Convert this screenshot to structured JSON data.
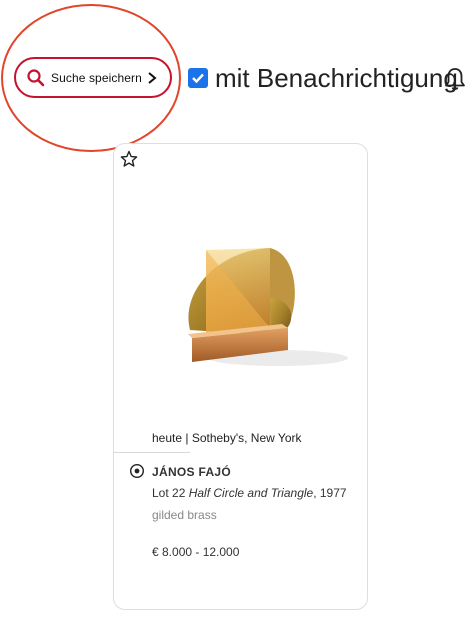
{
  "save_search": {
    "label": "Suche speichern",
    "icon": "search-icon",
    "color": "#c4122f"
  },
  "notification": {
    "checked": true,
    "label": "mit Benachrichtigung",
    "icon": "bell-icon"
  },
  "card": {
    "favorite_icon": "star-icon",
    "image_icon": "artwork-image",
    "date_venue": "heute | Sotheby's, New York",
    "artist": "JÁNOS FAJÓ",
    "lot_prefix": "Lot 22",
    "title": "Half Circle and Triangle",
    "year": ", 1977",
    "material": "gilded brass",
    "estimate": "€ 8.000 - 12.000"
  },
  "annotation": {
    "color": "#e0462a"
  }
}
